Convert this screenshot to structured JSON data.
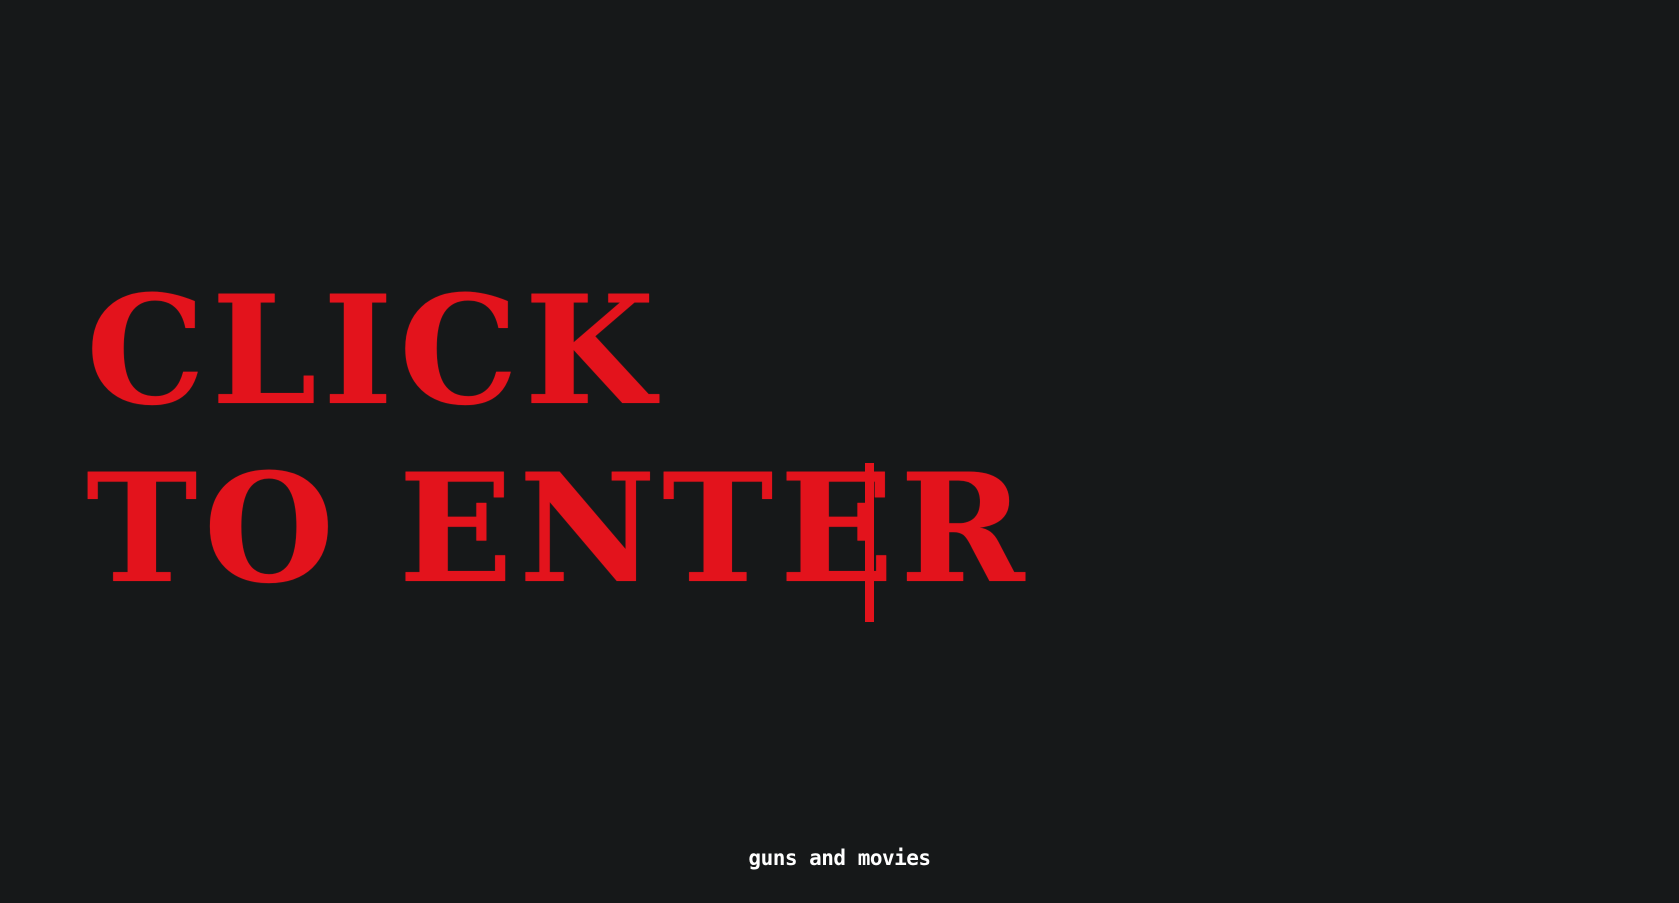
{
  "hero": {
    "line1": "CLICK",
    "line2": "TO ENTER"
  },
  "footer": {
    "site_name": "guns and movies"
  },
  "colors": {
    "background": "#161819",
    "accent": "#e3131c",
    "footer_text": "#ffffff"
  },
  "icons": {
    "cursor": "text-cursor-bar"
  }
}
